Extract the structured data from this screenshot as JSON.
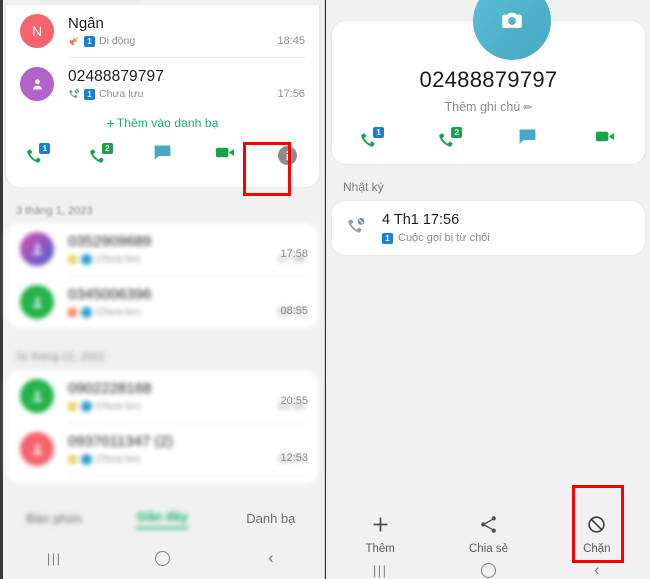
{
  "left_panel": {
    "recent_card": {
      "entries": [
        {
          "avatar_letter": "N",
          "avatar_color": "#f4636e",
          "name": "Ngân",
          "call_type_icon": "missed-call-icon",
          "sim": "1",
          "subtitle": "Di động",
          "time": "18:45"
        },
        {
          "avatar_letter": "",
          "avatar_color": "#b063c8",
          "name": "02488879797",
          "call_type_icon": "rejected-call-icon",
          "sim": "1",
          "subtitle": "Chưa lưu",
          "time": "17:56"
        }
      ],
      "add_contact_label": "Thêm vào danh bạ",
      "add_contact_plus": "+",
      "actions": [
        {
          "name": "call-sim1-icon",
          "badge": "1",
          "badge_color": "#1a7fd4"
        },
        {
          "name": "call-sim2-icon",
          "badge": "2",
          "badge_color": "#17a34a"
        },
        {
          "name": "message-icon",
          "badge": "",
          "badge_color": ""
        },
        {
          "name": "video-call-icon",
          "badge": "",
          "badge_color": ""
        },
        {
          "name": "info-icon",
          "badge": "",
          "badge_color": ""
        }
      ],
      "info_glyph": "i"
    },
    "date_group_1": "3 tháng 1, 2023",
    "date_group_2": "31 tháng 12, 2022",
    "group1_entries": [
      {
        "name": "0352909689",
        "avatar_color": "#6d5fd0",
        "subtitle": "Chưa lưu",
        "time": "17:58"
      },
      {
        "name": "0345006396",
        "avatar_color": "#24b24b",
        "subtitle": "Chưa lưu",
        "time": "08:55"
      }
    ],
    "group2_entries": [
      {
        "name": "0902228168",
        "avatar_color": "#24b24b",
        "subtitle": "Chưa lưu",
        "time": "20:55"
      },
      {
        "name": "0937011347 (2)",
        "avatar_color": "#f4636e",
        "subtitle": "Chưa lưu",
        "time": "12:53"
      }
    ],
    "tabs": [
      {
        "label": "Bàn phím",
        "active": false
      },
      {
        "label": "Gần đây",
        "active": true
      },
      {
        "label": "Danh bạ",
        "active": false
      }
    ],
    "navbar": [
      {
        "name": "recents-nav-icon",
        "glyph": "|||"
      },
      {
        "name": "home-nav-icon",
        "glyph": ""
      },
      {
        "name": "back-nav-icon",
        "glyph": "‹"
      }
    ]
  },
  "right_panel": {
    "avatar_icon": "camera-icon",
    "avatar_color": "#4eb1c9",
    "number": "02488879797",
    "note_label": "Thêm ghi chú",
    "note_pencil": "✏",
    "actions": [
      {
        "name": "call-sim1-icon",
        "badge": "1",
        "badge_color": "#1a7fd4"
      },
      {
        "name": "call-sim2-icon",
        "badge": "2",
        "badge_color": "#17a34a"
      },
      {
        "name": "message-icon",
        "badge": "",
        "badge_color": ""
      },
      {
        "name": "video-call-icon",
        "badge": "",
        "badge_color": ""
      }
    ],
    "log_section_title": "Nhật ký",
    "log_entry": {
      "icon": "rejected-call-icon",
      "title": "4 Th1 17:56",
      "sim": "1",
      "subtitle": "Cuộc gọi bị từ chối"
    },
    "bottom_actions": [
      {
        "name": "add-button",
        "icon": "plus-icon",
        "label": "Thêm"
      },
      {
        "name": "share-button",
        "icon": "share-icon",
        "label": "Chia sẻ"
      },
      {
        "name": "block-button",
        "icon": "block-icon",
        "label": "Chặn"
      }
    ],
    "navbar": [
      {
        "name": "recents-nav-icon",
        "glyph": "|||"
      },
      {
        "name": "home-nav-icon",
        "glyph": ""
      },
      {
        "name": "back-nav-icon",
        "glyph": "‹"
      }
    ]
  },
  "highlights": {
    "color": "#fb0000",
    "boxes": [
      {
        "name": "highlight-info-button",
        "target": "info-icon"
      },
      {
        "name": "highlight-block-button",
        "target": "block-button"
      }
    ]
  }
}
